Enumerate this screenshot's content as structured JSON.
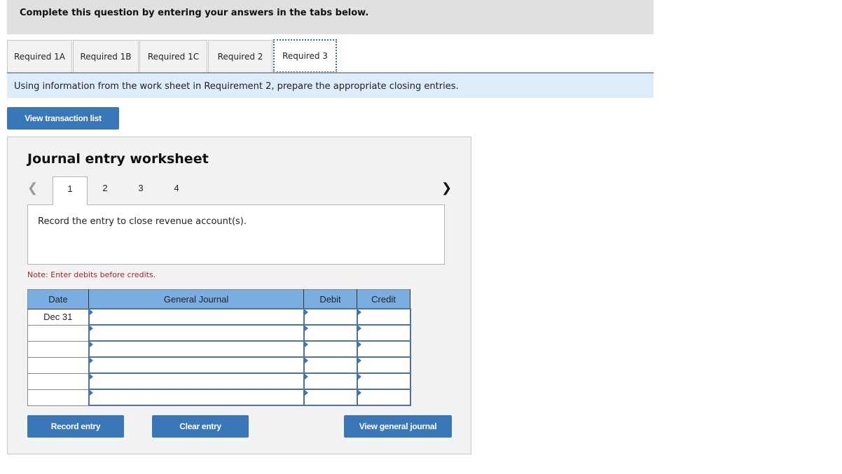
{
  "banner": {
    "text": "Complete this question by entering your answers in the tabs below."
  },
  "tabs": [
    {
      "label": "Required 1A",
      "active": false
    },
    {
      "label": "Required 1B",
      "active": false
    },
    {
      "label": "Required 1C",
      "active": false
    },
    {
      "label": "Required 2",
      "active": false
    },
    {
      "label": "Required 3",
      "active": true
    }
  ],
  "instruction": "Using information from the work sheet in Requirement 2, prepare the appropriate closing entries.",
  "view_transaction_list_label": "View transaction list",
  "worksheet": {
    "title": "Journal entry worksheet",
    "prev_icon": "chevron-left-icon",
    "next_icon": "chevron-right-icon",
    "steps": [
      "1",
      "2",
      "3",
      "4"
    ],
    "active_step": "1",
    "description": "Record the entry to close revenue account(s).",
    "note": "Note: Enter debits before credits.",
    "table": {
      "headers": {
        "date": "Date",
        "general_journal": "General Journal",
        "debit": "Debit",
        "credit": "Credit"
      },
      "rows": [
        {
          "date": "Dec 31",
          "account": "",
          "debit": "",
          "credit": ""
        },
        {
          "date": "",
          "account": "",
          "debit": "",
          "credit": ""
        },
        {
          "date": "",
          "account": "",
          "debit": "",
          "credit": ""
        },
        {
          "date": "",
          "account": "",
          "debit": "",
          "credit": ""
        },
        {
          "date": "",
          "account": "",
          "debit": "",
          "credit": ""
        },
        {
          "date": "",
          "account": "",
          "debit": "",
          "credit": ""
        }
      ]
    },
    "buttons": {
      "record": "Record entry",
      "clear": "Clear entry",
      "view_journal": "View general journal"
    }
  },
  "colors": {
    "button_blue": "#3a77b9",
    "header_blue": "#7aaee3",
    "instruction_bg": "#dcecf8",
    "note_red": "#a0282b"
  }
}
